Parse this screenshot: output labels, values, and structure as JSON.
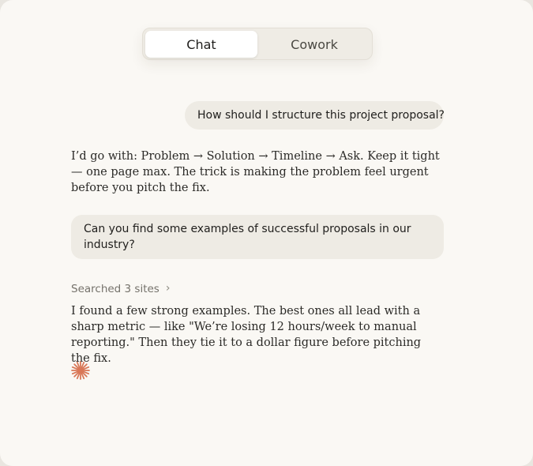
{
  "toggle": {
    "chat_label": "Chat",
    "cowork_label": "Cowork",
    "selected": "Chat"
  },
  "messages": {
    "user_1": "How should I structure this project proposal?",
    "assistant_1": "I’d go with: Problem → Solution → Timeline → Ask. Keep it tight — one page max. The trick is making the problem feel urgent before you pitch the fix.",
    "user_2": "Can you find some examples of successful proposals in our industry?",
    "search_status": "Searched 3 sites",
    "assistant_2": "I found a few strong examples. The best ones all lead with a sharp metric — like \"We’re losing 12 hours/week to manual reporting.\" Then they tie it to a dollar figure before pitching the fix."
  },
  "icons": {
    "chevron": "chevron-right-icon",
    "status": "spark-icon"
  },
  "colors": {
    "background": "#faf8f4",
    "user_bubble": "#eeebe4",
    "accent": "#d97757"
  }
}
